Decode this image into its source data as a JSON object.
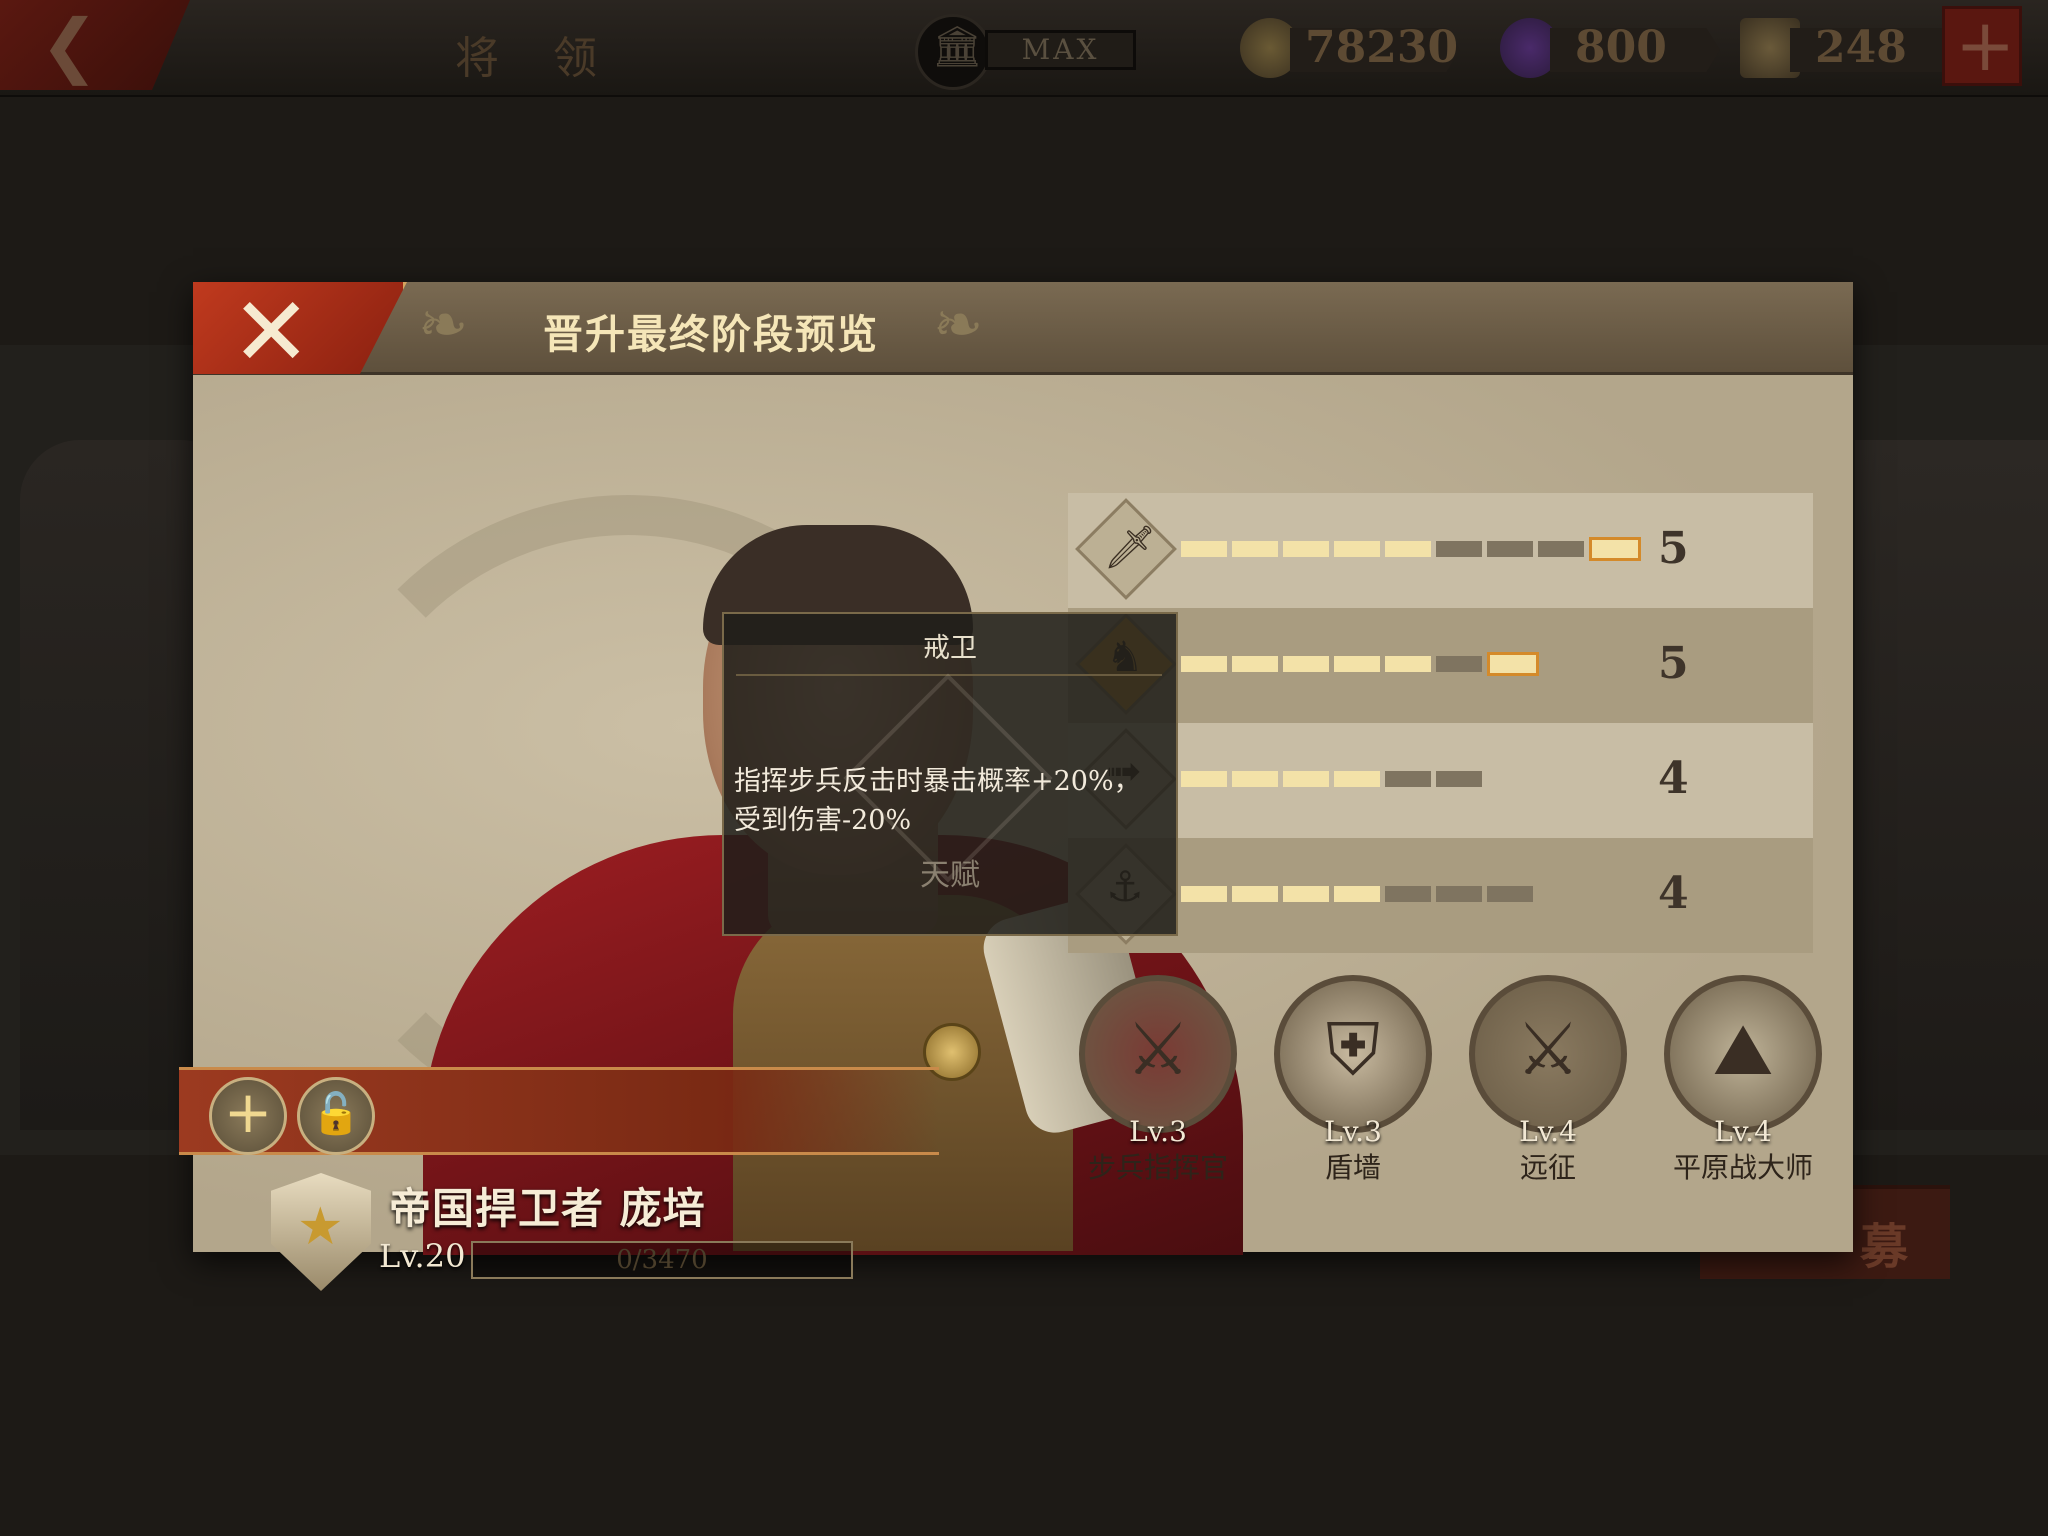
{
  "topbar": {
    "title": "将 领",
    "building_level": "MAX",
    "resources": [
      {
        "icon": "coin-icon",
        "value": "78230",
        "color": "#8a7a4a"
      },
      {
        "icon": "gem-icon",
        "value": "800",
        "color": "#4a2a6a"
      },
      {
        "icon": "medal-crate-icon",
        "value": "248",
        "color": "#6a5a3a"
      }
    ]
  },
  "background": {
    "recruit_glyph": "募"
  },
  "dialog": {
    "title": "晋升最终阶段预览",
    "close_icon": "close-icon"
  },
  "commander": {
    "name": "帝国捍卫者 庞培",
    "level": "Lv.20",
    "xp": "0/3470",
    "xp_fraction": 0.0
  },
  "attributes": [
    {
      "icon": "sword-icon",
      "filled": 5,
      "total": 9,
      "next_highlight": true,
      "value": "5"
    },
    {
      "icon": "horse-icon",
      "filled": 5,
      "total": 7,
      "next_highlight": true,
      "value": "5"
    },
    {
      "icon": "bow-icon",
      "filled": 4,
      "total": 6,
      "next_highlight": false,
      "value": "4"
    },
    {
      "icon": "anchor-icon",
      "filled": 4,
      "total": 7,
      "next_highlight": false,
      "value": "4"
    }
  ],
  "skills": [
    {
      "level": "Lv.3",
      "name": "步兵指挥官",
      "icon": "crossed-swords-icon",
      "color": "#7a3a34"
    },
    {
      "level": "Lv.3",
      "name": "盾墙",
      "icon": "shield-wall-icon",
      "color": "#c8baa0"
    },
    {
      "level": "Lv.4",
      "name": "远征",
      "icon": "marching-soldiers-icon",
      "color": "#8a7a60"
    },
    {
      "level": "Lv.4",
      "name": "平原战大师",
      "icon": "plains-icon",
      "color": "#bfb398"
    }
  ],
  "tooltip": {
    "title": "戒卫",
    "description": "指挥步兵反击时暴击概率+20%，受到伤害-20%",
    "subtitle": "天赋"
  }
}
